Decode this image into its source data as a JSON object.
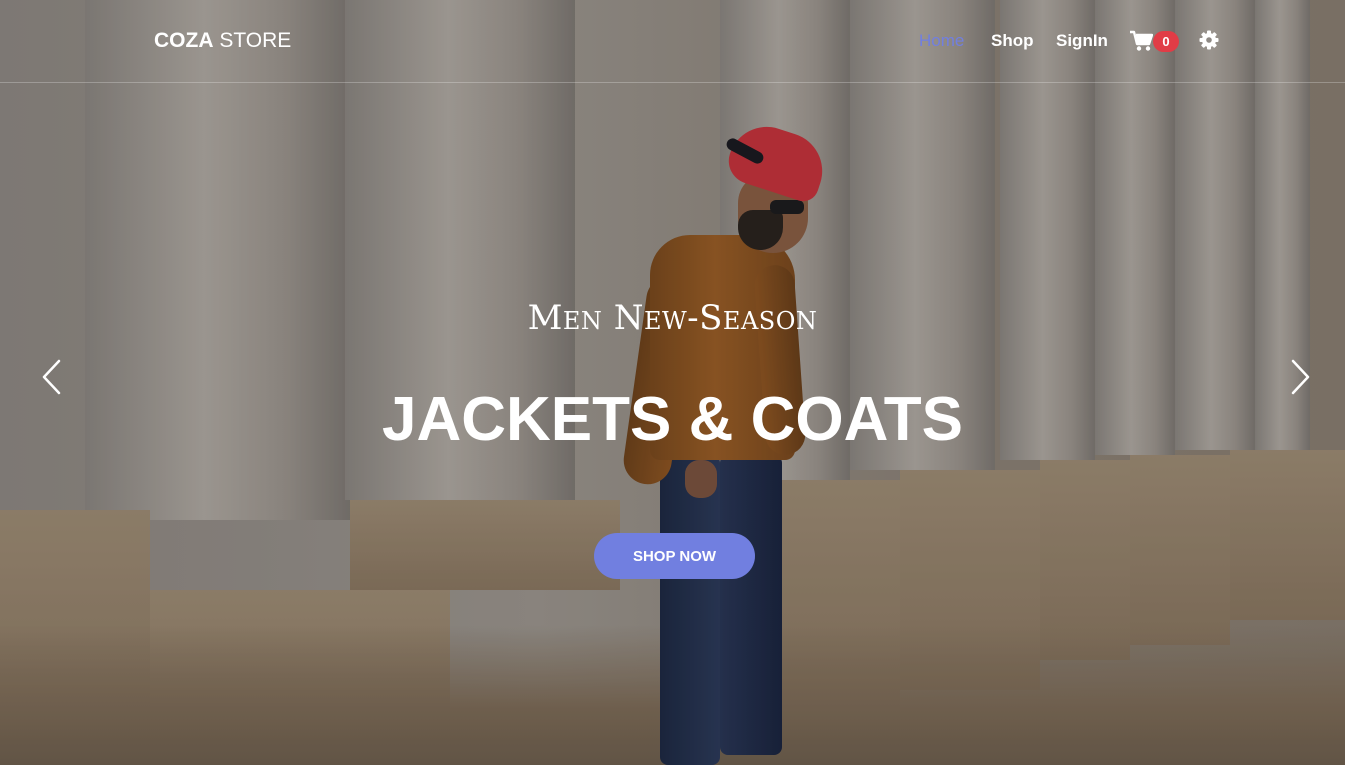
{
  "header": {
    "logo_bold": "COZA",
    "logo_light": "STORE",
    "nav": {
      "home": "Home",
      "shop": "Shop",
      "signin": "SignIn"
    },
    "cart_icon": "cart-icon",
    "cart_count": "0",
    "settings_icon": "gear-icon"
  },
  "hero": {
    "subtitle": "Men New-Season",
    "title": "JACKETS & COATS",
    "cta_label": "SHOP NOW",
    "prev_icon": "chevron-left-icon",
    "next_icon": "chevron-right-icon"
  },
  "colors": {
    "accent": "#717fe0",
    "badge": "#e13c46",
    "text": "#ffffff"
  }
}
